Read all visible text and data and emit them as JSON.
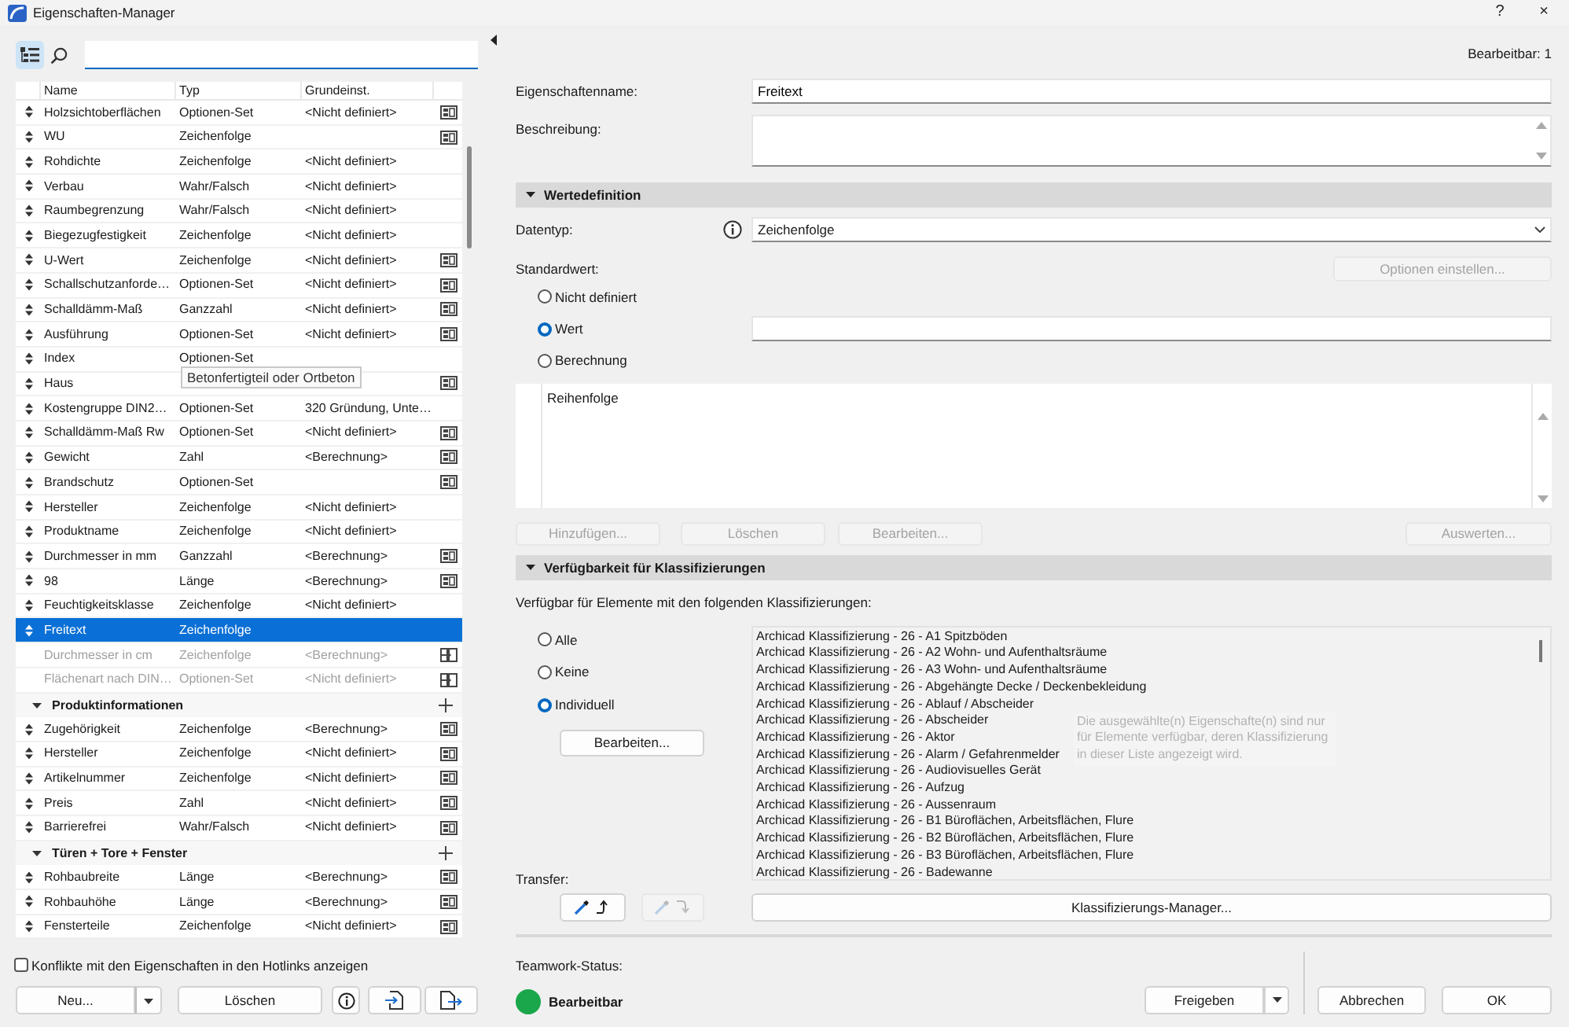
{
  "window": {
    "title": "Eigenschaften-Manager",
    "help_button": "?",
    "close_button": "×"
  },
  "toolbar": {
    "list_view": {
      "selected": true
    }
  },
  "table": {
    "columns": [
      "Name",
      "Typ",
      "Grundeinst."
    ],
    "groups": [
      {
        "rows": [
          {
            "kind": "custom",
            "name": "Holzsichtoberflächen",
            "type": "Optionen-Set",
            "default": "<Nicht definiert>",
            "selected": false,
            "disabled": false
          },
          {
            "kind": "custom",
            "name": "WU",
            "type": "Zeichenfolge",
            "selected": false,
            "disabled": false
          },
          {
            "kind": "plain",
            "name": "Rohdichte",
            "type": "Zeichenfolge",
            "default": "<Nicht definiert>",
            "selected": false,
            "disabled": false
          },
          {
            "kind": "plain",
            "name": "Verbau",
            "type": "Wahr/Falsch",
            "default": "<Nicht definiert>",
            "selected": false,
            "disabled": false
          },
          {
            "kind": "plain",
            "name": "Raumbegrenzung",
            "type": "Wahr/Falsch",
            "default": "<Nicht definiert>",
            "selected": false,
            "disabled": false
          },
          {
            "kind": "plain",
            "name": "Biegezugfestigkeit",
            "type": "Zeichenfolge",
            "default": "<Nicht definiert>",
            "selected": false,
            "disabled": false
          },
          {
            "kind": "custom",
            "name": "U-Wert",
            "type": "Zeichenfolge",
            "default": "<Nicht definiert>",
            "selected": false,
            "disabled": false
          },
          {
            "kind": "custom",
            "name": "Schallschutzanforde…",
            "type": "Optionen-Set",
            "default": "<Nicht definiert>",
            "selected": false,
            "disabled": false
          },
          {
            "kind": "custom",
            "name": "Schalldämm-Maß",
            "type": "Ganzzahl",
            "default": "<Nicht definiert>",
            "selected": false,
            "disabled": false
          },
          {
            "kind": "custom",
            "name": "Ausführung",
            "type": "Optionen-Set",
            "default": "<Nicht definiert>",
            "selected": false,
            "disabled": false
          },
          {
            "kind": "plain",
            "name": "Index",
            "type": "Optionen-Set",
            "selected": false,
            "disabled": false
          },
          {
            "kind": "custom",
            "name": "Haus",
            "selected": false,
            "disabled": false
          },
          {
            "kind": "plain",
            "name": "Kostengruppe DIN2…",
            "type": "Optionen-Set",
            "default": "320 Gründung, Unte…",
            "selected": false,
            "disabled": false
          },
          {
            "kind": "custom",
            "name": "Schalldämm-Maß Rw",
            "type": "Optionen-Set",
            "default": "<Nicht definiert>",
            "selected": false,
            "disabled": false
          },
          {
            "kind": "custom",
            "name": "Gewicht",
            "type": "Zahl",
            "default": "<Berechnung>",
            "selected": false,
            "disabled": false
          },
          {
            "kind": "custom",
            "name": "Brandschutz",
            "type": "Optionen-Set",
            "selected": false,
            "disabled": false
          },
          {
            "kind": "plain",
            "name": "Hersteller",
            "type": "Zeichenfolge",
            "default": "<Nicht definiert>",
            "selected": false,
            "disabled": false
          },
          {
            "kind": "plain",
            "name": "Produktname",
            "type": "Zeichenfolge",
            "default": "<Nicht definiert>",
            "selected": false,
            "disabled": false
          },
          {
            "kind": "custom",
            "name": "Durchmesser in mm",
            "type": "Ganzzahl",
            "default": "<Berechnung>",
            "selected": false,
            "disabled": false
          },
          {
            "kind": "custom",
            "name": "98",
            "type": "Länge",
            "default": "<Berechnung>",
            "selected": false,
            "disabled": false
          },
          {
            "kind": "plain",
            "name": "Feuchtigkeitsklasse",
            "type": "Zeichenfolge",
            "default": "<Nicht definiert>",
            "selected": false,
            "disabled": false
          },
          {
            "kind": "plain",
            "name": "Freitext",
            "type": "Zeichenfolge",
            "selected": true,
            "disabled": false
          },
          {
            "kind": "linked",
            "name": "Durchmesser in cm",
            "type": "Zeichenfolge",
            "default": "<Berechnung>",
            "selected": false,
            "disabled": true
          },
          {
            "kind": "linked",
            "name": "Flächenart nach DIN…",
            "type": "Optionen-Set",
            "default": "<Nicht definiert>",
            "selected": false,
            "disabled": true
          }
        ]
      },
      {
        "name": "Produktinformationen",
        "expanded": true,
        "rows": [
          {
            "kind": "custom",
            "name": "Zugehörigkeit",
            "type": "Zeichenfolge",
            "default": "<Berechnung>",
            "selected": false,
            "disabled": false
          },
          {
            "kind": "custom",
            "name": "Hersteller",
            "type": "Zeichenfolge",
            "default": "<Nicht definiert>",
            "selected": false,
            "disabled": false
          },
          {
            "kind": "custom",
            "name": "Artikelnummer",
            "type": "Zeichenfolge",
            "default": "<Nicht definiert>",
            "selected": false,
            "disabled": false
          },
          {
            "kind": "custom",
            "name": "Preis",
            "type": "Zahl",
            "default": "<Nicht definiert>",
            "selected": false,
            "disabled": false
          },
          {
            "kind": "custom",
            "name": "Barrierefrei",
            "type": "Wahr/Falsch",
            "default": "<Nicht definiert>",
            "selected": false,
            "disabled": false
          }
        ]
      },
      {
        "name": "Türen + Tore + Fenster",
        "expanded": true,
        "rows": [
          {
            "kind": "custom",
            "name": "Rohbaubreite",
            "type": "Länge",
            "default": "<Berechnung>",
            "selected": false,
            "disabled": false
          },
          {
            "kind": "custom",
            "name": "Rohbauhöhe",
            "type": "Länge",
            "default": "<Berechnung>",
            "selected": false,
            "disabled": false
          },
          {
            "kind": "custom",
            "name": "Fensterteile",
            "type": "Zeichenfolge",
            "default": "<Nicht definiert>",
            "selected": false,
            "disabled": false
          }
        ]
      }
    ]
  },
  "tooltip": "Betonfertigteil oder Ortbeton",
  "hotlink_conflicts": {
    "label": "Konflikte mit den Eigenschaften in den Hotlinks anzeigen",
    "checked": false
  },
  "left_buttons": [
    {
      "kind": "split",
      "label": "Neu..."
    },
    {
      "kind": "plain",
      "label": "Löschen"
    },
    {
      "kind": "info"
    },
    {
      "kind": "import"
    },
    {
      "kind": "export"
    }
  ],
  "editable_count": "Bearbeitbar: 1",
  "name_field": {
    "label": "Eigenschaftenname:",
    "value": "Freitext"
  },
  "description_field": {
    "label": "Beschreibung:"
  },
  "value_definition": {
    "title": "Wertedefinition",
    "expanded": true,
    "data_type": {
      "label": "Datentyp:",
      "value": "Zeichenfolge"
    },
    "default_label": "Standardwert:",
    "options_button": {
      "label": "Optionen einstellen...",
      "disabled": true
    },
    "choices": [
      {
        "label": "Nicht definiert",
        "selected": false
      },
      {
        "label": "Wert",
        "selected": true
      },
      {
        "label": "Berechnung",
        "selected": false
      }
    ],
    "order_column": "Reihenfolge",
    "buttons": [
      {
        "label": "Hinzufügen...",
        "disabled": true
      },
      {
        "label": "Löschen",
        "disabled": true
      },
      {
        "label": "Bearbeiten...",
        "disabled": true
      }
    ],
    "evaluate_button": {
      "label": "Auswerten...",
      "disabled": true
    }
  },
  "classification": {
    "title": "Verfügbarkeit für Klassifizierungen",
    "expanded": true,
    "intro": "Verfügbar für Elemente mit den folgenden Klassifizierungen:",
    "choices": [
      {
        "label": "Alle",
        "selected": false
      },
      {
        "label": "Keine",
        "selected": false
      },
      {
        "label": "Individuell",
        "selected": true
      }
    ],
    "edit_button": {
      "label": "Bearbeiten...",
      "disabled": false
    },
    "items": [
      "Archicad Klassifizierung - 26 - A1 Spitzböden",
      "Archicad Klassifizierung - 26 - A2 Wohn- und Aufenthaltsräume",
      "Archicad Klassifizierung - 26 - A3 Wohn- und Aufenthaltsräume",
      "Archicad Klassifizierung - 26 - Abgehängte Decke / Deckenbekleidung",
      "Archicad Klassifizierung - 26 - Ablauf / Abscheider",
      "Archicad Klassifizierung - 26 - Abscheider",
      "Archicad Klassifizierung - 26 - Aktor",
      "Archicad Klassifizierung - 26 - Alarm / Gefahrenmelder",
      "Archicad Klassifizierung - 26 - Audiovisuelles Gerät",
      "Archicad Klassifizierung - 26 - Aufzug",
      "Archicad Klassifizierung - 26 - Aussenraum",
      "Archicad Klassifizierung - 26 - B1 Büroflächen, Arbeitsflächen, Flure",
      "Archicad Klassifizierung - 26 - B2 Büroflächen, Arbeitsflächen, Flure",
      "Archicad Klassifizierung - 26 - B3 Büroflächen, Arbeitsflächen, Flure",
      "Archicad Klassifizierung - 26 - Badewanne"
    ],
    "hint": "Die ausgewählte(n) Eigenschafte(n) sind nur für Elemente verfügbar, deren Klassifizierung in dieser Liste angezeigt wird.",
    "transfer_label": "Transfer:",
    "transfer_buttons": [
      {
        "kind": "pick",
        "disabled": false
      },
      {
        "kind": "inject",
        "disabled": true
      }
    ],
    "manager_button": "Klassifizierungs-Manager..."
  },
  "teamwork": {
    "label": "Teamwork-Status:",
    "status": "Bearbeitbar",
    "color": "#1aa64a"
  },
  "release_button": {
    "label": "Freigeben"
  },
  "dialog_buttons": [
    "Abbrechen",
    "OK"
  ]
}
